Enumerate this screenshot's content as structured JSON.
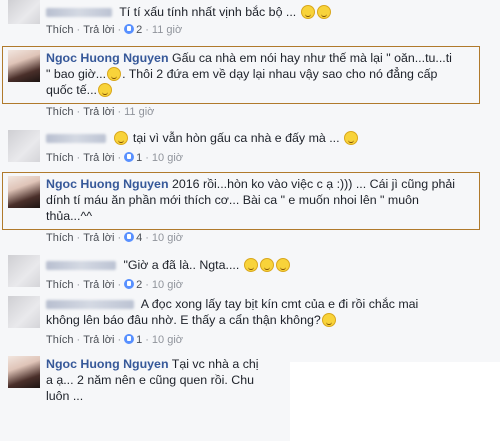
{
  "actions": {
    "like": "Thích",
    "reply": "Trả lời"
  },
  "comments": [
    {
      "line1": "Tí tí xấu tính nhất vịnh bắc bộ ...",
      "likes": "2",
      "time": "11 giờ"
    },
    {
      "name": "Ngoc Huong Nguyen",
      "line1": "Gấu ca nhà em nói hay như thế mà lại \" oăn...tu...ti",
      "line2": "\" bao giờ...",
      "line2b": ". Thôi 2 đứa em về dạy lại nhau vậy sao cho nó đẳng cấp",
      "line3": "quốc tế...",
      "time": "11 giờ"
    },
    {
      "line1": "tại vì vẫn hòn gấu ca nhà e đấy mà ...",
      "likes": "1",
      "time": "10 giờ"
    },
    {
      "name": "Ngoc Huong Nguyen",
      "line1": "2016 rồi...hòn ko vào việc c ạ :))) ... Cái jì cũng phải",
      "line2": "dính tí máu ăn phần mới thích cơ... Bài ca \" e muốn nhoi lên \" muôn",
      "line3": "thủa...^^",
      "likes": "4",
      "time": "10 giờ"
    },
    {
      "line1": "\"Giờ a đã là.. Ngta....",
      "likes": "2",
      "time": "10 giờ"
    },
    {
      "line1": "A đọc xong lấy tay bịt kín cmt của e đi rồi chắc mai",
      "line2": "không lên báo đâu nhờ. E thấy a cẩn thận không?",
      "likes": "1",
      "time": "10 giờ"
    },
    {
      "name": "Ngoc Huong Nguyen",
      "line1": "Tại vc nhà a chị",
      "line2": "a ạ... 2 năm nên e cũng quen rồi. Chu",
      "line3": "luôn ..."
    }
  ],
  "colors": {
    "link": "#365899",
    "meta": "#90949c",
    "highlight": "#b07a2c",
    "like": "#5890ff"
  }
}
